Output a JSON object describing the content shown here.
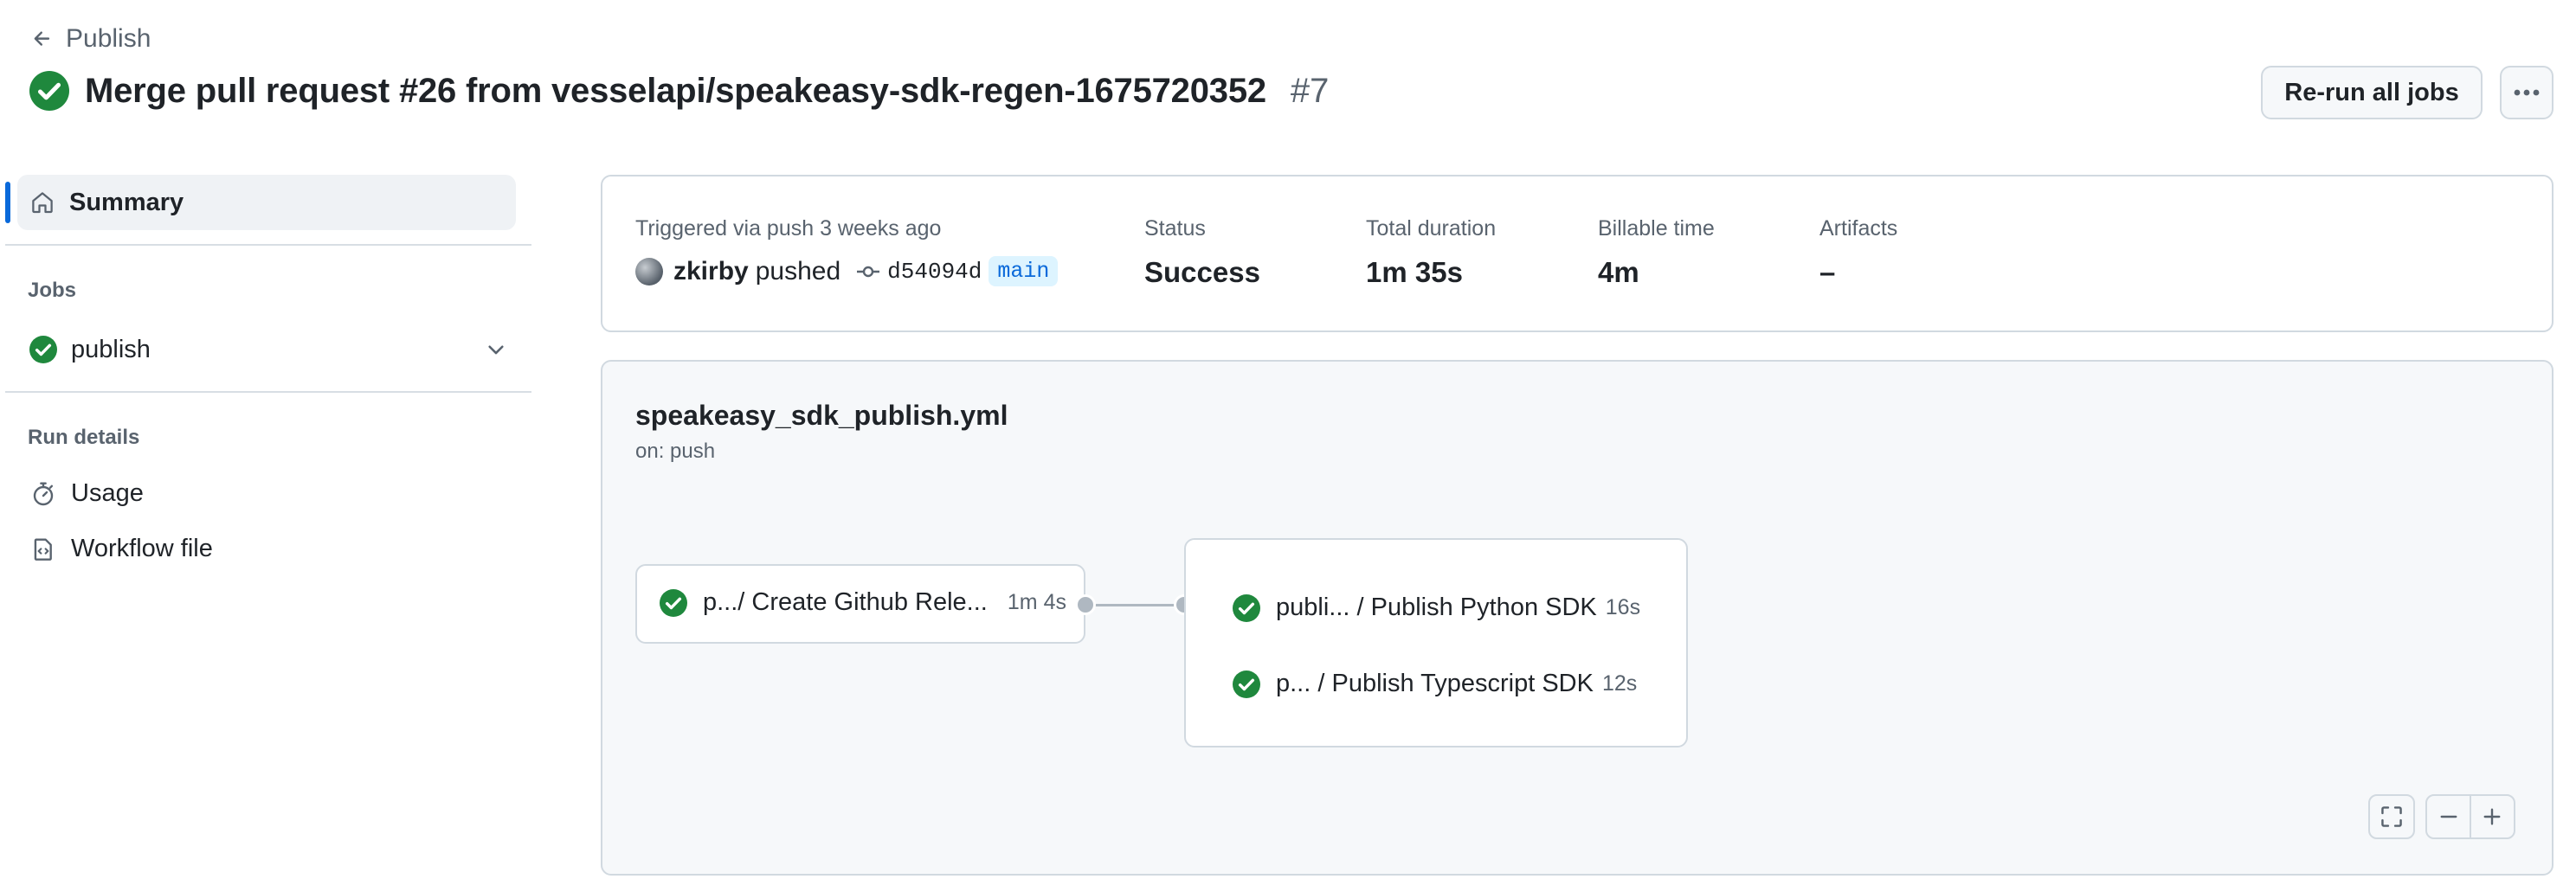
{
  "header": {
    "back_label": "Publish",
    "title": "Merge pull request #26 from vesselapi/speakeasy-sdk-regen-1675720352",
    "run_number": "#7",
    "rerun_label": "Re-run all jobs"
  },
  "sidebar": {
    "summary_label": "Summary",
    "jobs_heading": "Jobs",
    "jobs": [
      {
        "label": "publish",
        "status": "success"
      }
    ],
    "run_details_heading": "Run details",
    "details": [
      {
        "label": "Usage",
        "icon": "stopwatch-icon"
      },
      {
        "label": "Workflow file",
        "icon": "file-code-icon"
      }
    ]
  },
  "summary": {
    "triggered_label": "Triggered via push 3 weeks ago",
    "user": "zkirby",
    "action": "pushed",
    "commit": "d54094d",
    "branch": "main",
    "status_label": "Status",
    "status_value": "Success",
    "duration_label": "Total duration",
    "duration_value": "1m 35s",
    "billable_label": "Billable time",
    "billable_value": "4m",
    "artifacts_label": "Artifacts",
    "artifacts_value": "–"
  },
  "workflow": {
    "file": "speakeasy_sdk_publish.yml",
    "trigger": "on: push",
    "jobs": [
      {
        "name": "p.../ Create Github Rele...",
        "time": "1m 4s"
      },
      {
        "name": "publi... / Publish Python SDK",
        "time": "16s"
      },
      {
        "name": "p... / Publish Typescript SDK",
        "time": "12s"
      }
    ]
  },
  "colors": {
    "success": "#1f883d",
    "accent": "#0969da",
    "border": "#d1d9e0",
    "muted": "#59636e"
  }
}
